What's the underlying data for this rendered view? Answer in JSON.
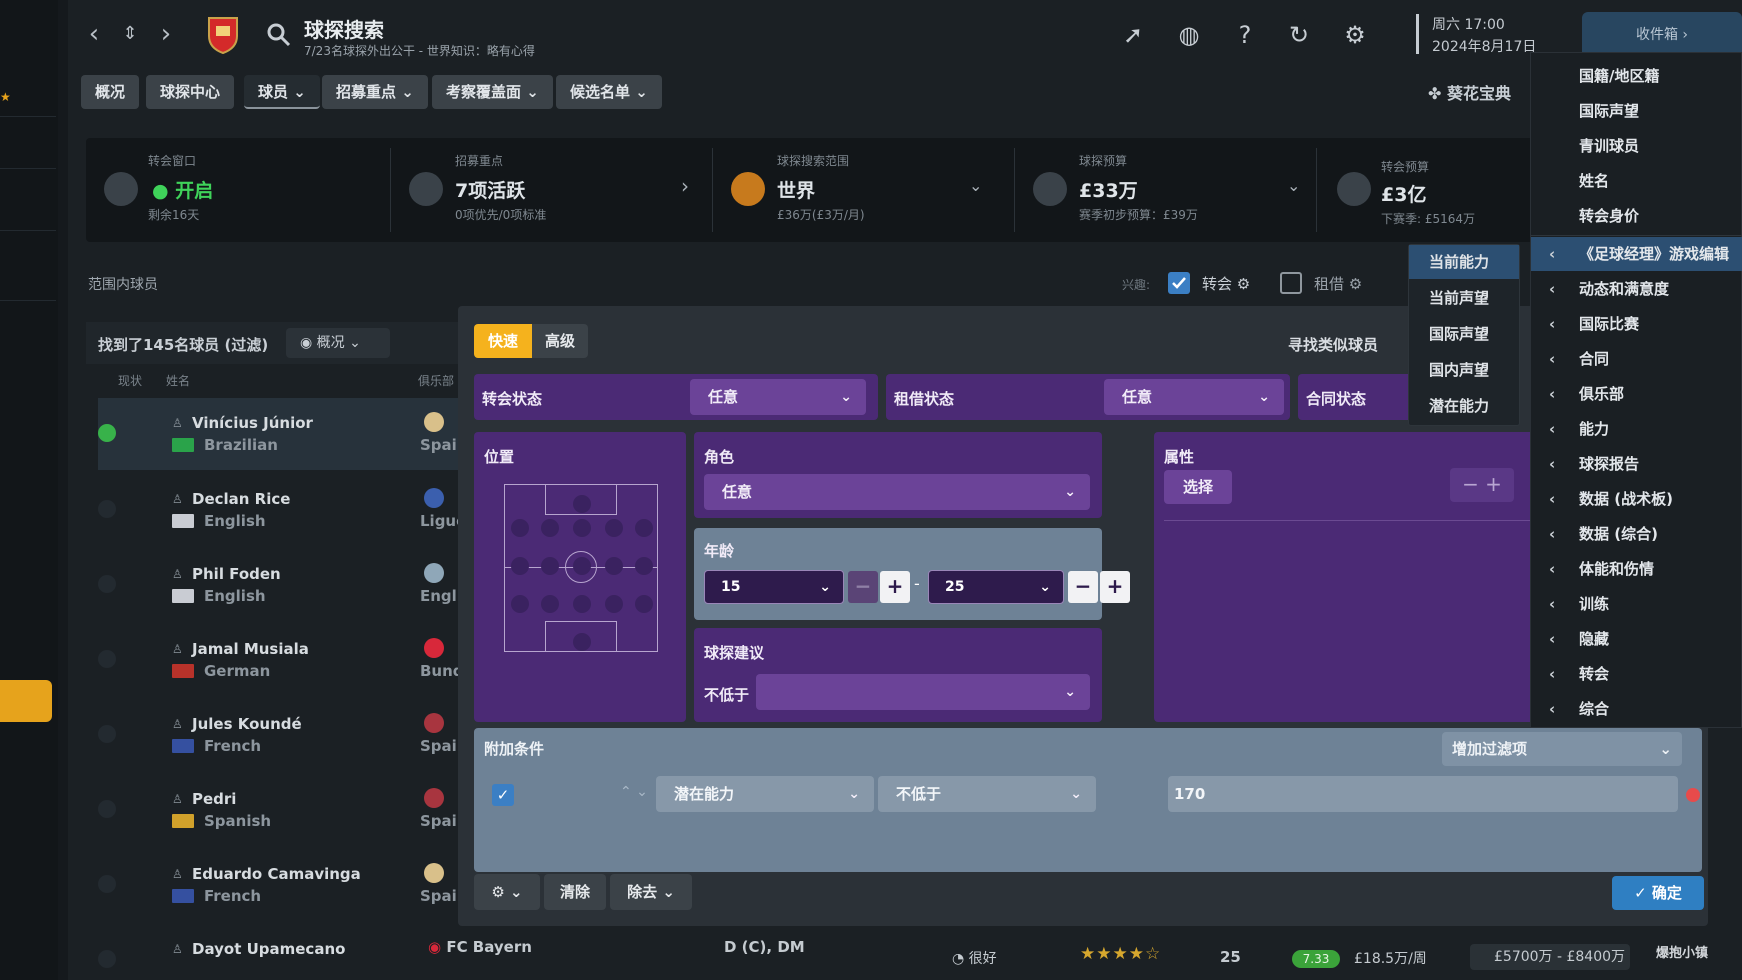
{
  "header": {
    "title": "球探搜索",
    "subtitle": "7/23名球探外出公干 - 世界知识：略有心得",
    "clock_day": "周六 17:00",
    "clock_date": "2024年8月17日",
    "inbox": "收件箱"
  },
  "tabs": [
    {
      "label": "概况"
    },
    {
      "label": "球探中心"
    },
    {
      "label": "球员"
    },
    {
      "label": "招募重点"
    },
    {
      "label": "考察覆盖面"
    },
    {
      "label": "候选名单"
    }
  ],
  "kuaihua": "葵花宝典",
  "infobar": {
    "window_label": "转会窗口",
    "window_value": "开启",
    "window_sub": "剩余16天",
    "focus_label": "招募重点",
    "focus_value": "7项活跃",
    "focus_sub": "0项优先/0项标准",
    "range_label": "球探搜索范围",
    "range_value": "世界",
    "range_sub": "£36万(£3万/月)",
    "budget_label": "球探预算",
    "budget_value": "£33万",
    "budget_sub": "赛季初步预算：£39万",
    "transfer_label": "转会预算",
    "transfer_value": "£3亿",
    "transfer_sub": "下赛季: £5164万"
  },
  "underbar": {
    "range_label": "范围内球员",
    "interest_label": "兴趣:",
    "transfer_label": "转会",
    "loan_label": "租借"
  },
  "list": {
    "found": "找到了145名球员 (过滤)",
    "view": "概况",
    "col_status": "现状",
    "col_name": "姓名",
    "col_club": "俱乐部",
    "players": [
      {
        "name": "Vinícius Júnior",
        "nat": "Brazilian",
        "club": "Spain"
      },
      {
        "name": "Declan Rice",
        "nat": "English",
        "club": "Ligue"
      },
      {
        "name": "Phil Foden",
        "nat": "English",
        "club": "Engli"
      },
      {
        "name": "Jamal Musiala",
        "nat": "German",
        "club": "Bund"
      },
      {
        "name": "Jules Koundé",
        "nat": "French",
        "club": "Spain"
      },
      {
        "name": "Pedri",
        "nat": "Spanish",
        "club": "Spain"
      },
      {
        "name": "Eduardo Camavinga",
        "nat": "French",
        "club": "Spain"
      },
      {
        "name": "Dayot Upamecano",
        "nat": "",
        "club": ""
      }
    ],
    "last_row": {
      "club": "FC Bayern",
      "position": "D (C), DM",
      "fit": "很好",
      "age": "25",
      "rating": "7.33",
      "wage": "£18.5万/周",
      "value": "£5700万 - £8400万"
    }
  },
  "modal": {
    "tab_quick": "快速",
    "tab_advanced": "高级",
    "similar": "寻找类似球员",
    "transfer_status": "转会状态",
    "transfer_value": "任意",
    "loan_status": "租借状态",
    "loan_value": "任意",
    "contract_status": "合同状态",
    "position": "位置",
    "role": "角色",
    "role_value": "任意",
    "attributes": "属性",
    "select": "选择",
    "age": "年龄",
    "age_min": "15",
    "age_max": "25",
    "scout_rec": "球探建议",
    "scout_op": "不低于",
    "extra": "附加条件",
    "add_filter": "增加过滤项",
    "cond_field": "潜在能力",
    "cond_op": "不低于",
    "cond_value": "170",
    "clear": "清除",
    "remove": "除去",
    "confirm": "确定"
  },
  "sort_menu": [
    "当前能力",
    "当前声望",
    "国际声望",
    "国内声望",
    "潜在能力"
  ],
  "right_menu": {
    "plain": [
      "国籍/地区籍",
      "国际声望",
      "青训球员",
      "姓名",
      "转会身价"
    ],
    "sub": [
      "《足球经理》游戏编辑",
      "动态和满意度",
      "国际比赛",
      "合同",
      "俱乐部",
      "能力",
      "球探报告",
      "数据 (战术板)",
      "数据 (综合)",
      "体能和伤情",
      "训练",
      "隐藏",
      "转会",
      "综合"
    ]
  },
  "watermark": "爆抱小镇",
  "colors": {
    "purple_panel": "#4b2a75",
    "accent_yellow": "#f5b21d",
    "menu_active": "#2c4f72",
    "confirm_blue": "#2f7fc2"
  }
}
